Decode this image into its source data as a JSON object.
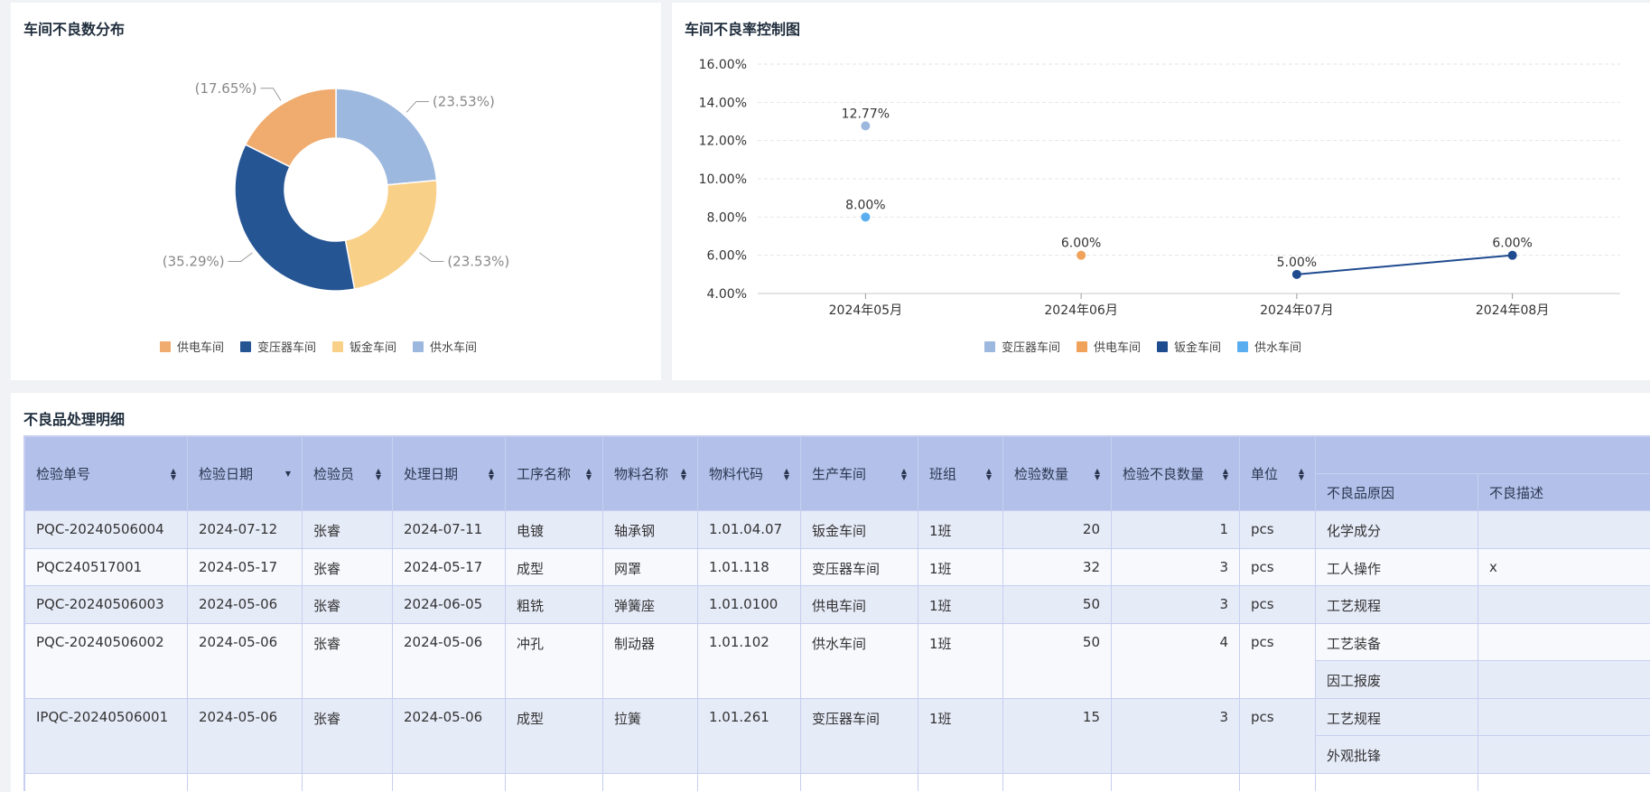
{
  "donut_card": {
    "title": "车间不良数分布",
    "slices": [
      {
        "name": "供水车间",
        "value": 23.53,
        "label": "(23.53%)",
        "color": "#9db8de"
      },
      {
        "name": "钣金车间",
        "value": 23.53,
        "label": "(23.53%)",
        "color": "#f9d088"
      },
      {
        "name": "变压器车间",
        "value": 35.29,
        "label": "(35.29%)",
        "color": "#265594"
      },
      {
        "name": "供电车间",
        "value": 17.65,
        "label": "(17.65%)",
        "color": "#f0ab6e"
      }
    ],
    "legend": [
      {
        "name": "供电车间",
        "color": "#f0ab6e"
      },
      {
        "name": "变压器车间",
        "color": "#265594"
      },
      {
        "name": "钣金车间",
        "color": "#f9d088"
      },
      {
        "name": "供水车间",
        "color": "#9db8de"
      }
    ]
  },
  "chart_data": [
    {
      "type": "pie",
      "title": "车间不良数分布",
      "categories": [
        "供水车间",
        "钣金车间",
        "变压器车间",
        "供电车间"
      ],
      "values": [
        23.53,
        23.53,
        35.29,
        17.65
      ]
    },
    {
      "type": "line",
      "title": "车间不良率控制图",
      "categories": [
        "2024年05月",
        "2024年06月",
        "2024年07月",
        "2024年08月"
      ],
      "ylim": [
        4,
        16
      ],
      "yticks": [
        "4.00%",
        "6.00%",
        "8.00%",
        "10.00%",
        "12.00%",
        "14.00%",
        "16.00%"
      ],
      "grid": true,
      "legend_position": "bottom",
      "series": [
        {
          "name": "变压器车间",
          "color": "#9db8de",
          "values": [
            12.77,
            null,
            null,
            null
          ],
          "labels": [
            "12.77%",
            "",
            "",
            ""
          ]
        },
        {
          "name": "供电车间",
          "color": "#f0a25a",
          "values": [
            null,
            6.0,
            null,
            null
          ],
          "labels": [
            "",
            "6.00%",
            "",
            ""
          ]
        },
        {
          "name": "钣金车间",
          "color": "#1f4b8f",
          "values": [
            null,
            null,
            5.0,
            6.0
          ],
          "labels": [
            "",
            "",
            "5.00%",
            "6.00%"
          ]
        },
        {
          "name": "供水车间",
          "color": "#5aaef0",
          "values": [
            8.0,
            null,
            null,
            null
          ],
          "labels": [
            "8.00%",
            "",
            "",
            ""
          ]
        }
      ]
    }
  ],
  "control_card": {
    "title": "车间不良率控制图"
  },
  "table_card": {
    "title": "不良品处理明细",
    "headers": {
      "order_no": "检验单号",
      "inspect_date": "检验日期",
      "inspector": "检验员",
      "process_date": "处理日期",
      "process_name": "工序名称",
      "material_name": "物料名称",
      "material_code": "物料代码",
      "workshop": "生产车间",
      "team": "班组",
      "inspect_qty": "检验数量",
      "defect_qty": "检验不良数量",
      "unit": "单位",
      "reason": "不良品原因",
      "desc": "不良描述"
    },
    "rows": [
      {
        "order_no": "PQC-20240506004",
        "inspect_date": "2024-07-12",
        "inspector": "张睿",
        "process_date": "2024-07-11",
        "process_name": "电镀",
        "material_name": "轴承钢",
        "material_code": "1.01.04.07",
        "workshop": "钣金车间",
        "team": "1班",
        "inspect_qty": "20",
        "defect_qty": "1",
        "unit": "pcs",
        "details": [
          {
            "reason": "化学成分",
            "desc": ""
          }
        ]
      },
      {
        "order_no": "PQC240517001",
        "inspect_date": "2024-05-17",
        "inspector": "张睿",
        "process_date": "2024-05-17",
        "process_name": "成型",
        "material_name": "网罩",
        "material_code": "1.01.118",
        "workshop": "变压器车间",
        "team": "1班",
        "inspect_qty": "32",
        "defect_qty": "3",
        "unit": "pcs",
        "details": [
          {
            "reason": "工人操作",
            "desc": "x"
          }
        ]
      },
      {
        "order_no": "PQC-20240506003",
        "inspect_date": "2024-05-06",
        "inspector": "张睿",
        "process_date": "2024-06-05",
        "process_name": "粗铣",
        "material_name": "弹簧座",
        "material_code": "1.01.0100",
        "workshop": "供电车间",
        "team": "1班",
        "inspect_qty": "50",
        "defect_qty": "3",
        "unit": "pcs",
        "details": [
          {
            "reason": "工艺规程",
            "desc": ""
          }
        ]
      },
      {
        "order_no": "PQC-20240506002",
        "inspect_date": "2024-05-06",
        "inspector": "张睿",
        "process_date": "2024-05-06",
        "process_name": "冲孔",
        "material_name": "制动器",
        "material_code": "1.01.102",
        "workshop": "供水车间",
        "team": "1班",
        "inspect_qty": "50",
        "defect_qty": "4",
        "unit": "pcs",
        "details": [
          {
            "reason": "工艺装备",
            "desc": ""
          },
          {
            "reason": "因工报废",
            "desc": ""
          }
        ]
      },
      {
        "order_no": "IPQC-20240506001",
        "inspect_date": "2024-05-06",
        "inspector": "张睿",
        "process_date": "2024-05-06",
        "process_name": "成型",
        "material_name": "拉簧",
        "material_code": "1.01.261",
        "workshop": "变压器车间",
        "team": "1班",
        "inspect_qty": "15",
        "defect_qty": "3",
        "unit": "pcs",
        "details": [
          {
            "reason": "工艺规程",
            "desc": ""
          },
          {
            "reason": "外观批锋",
            "desc": ""
          }
        ]
      }
    ]
  }
}
